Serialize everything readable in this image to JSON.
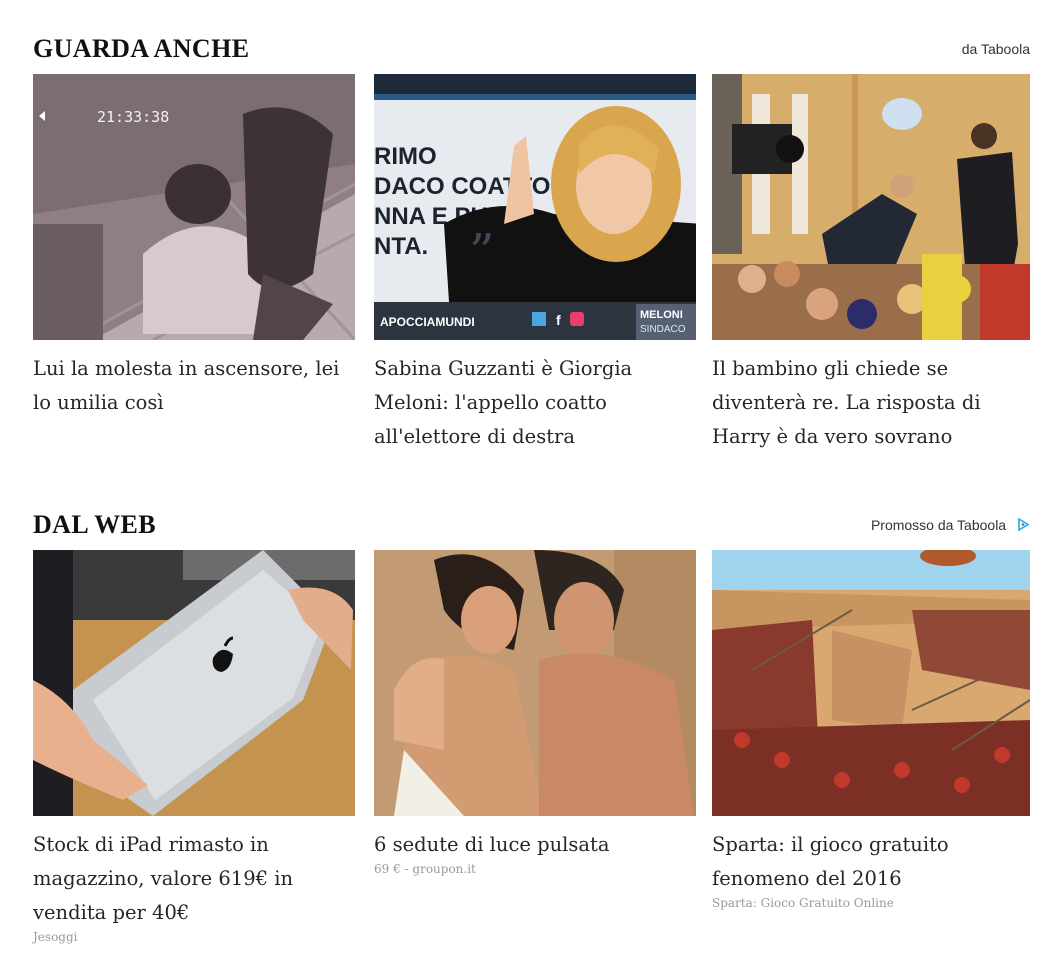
{
  "sections": [
    {
      "title": "GUARDA ANCHE",
      "brand": "da Taboola",
      "cards": [
        {
          "title": "Lui la molesta in ascensore, lei lo umilia così",
          "thumb_timestamp": "21:33:38"
        },
        {
          "title": "Sabina Guzzanti è Giorgia Meloni: l'appello coatto all'elettore di destra",
          "thumb_text": [
            "RIMO",
            "DACO COATTO",
            "NNA E PUR",
            "NTA."
          ],
          "thumb_footer": "APOCCIAMUNDI",
          "thumb_corner": [
            "MELONI",
            "SINDACO"
          ]
        },
        {
          "title": "Il bambino gli chiede se diventerà re. La risposta di Harry è da vero sovrano"
        }
      ]
    },
    {
      "title": "DAL WEB",
      "brand": "Promosso da Taboola",
      "cards": [
        {
          "title": "Stock di iPad rimasto in magazzino, valore 619€ in vendita per 40€",
          "source": "Jesoggi"
        },
        {
          "title": "6 sedute di luce pulsata",
          "source": "69 € - groupon.it"
        },
        {
          "title": "Sparta: il gioco gratuito fenomeno del 2016",
          "source": "Sparta: Gioco Gratuito Online"
        }
      ]
    }
  ],
  "icons": {
    "adchoices": "adchoices-icon",
    "twitter": "twitter-icon",
    "facebook": "facebook-icon",
    "instagram": "instagram-icon"
  },
  "colors": {
    "adchoices": "#2aa8e0",
    "heading": "#111111",
    "text": "#262626",
    "source": "#9a9a9a"
  }
}
